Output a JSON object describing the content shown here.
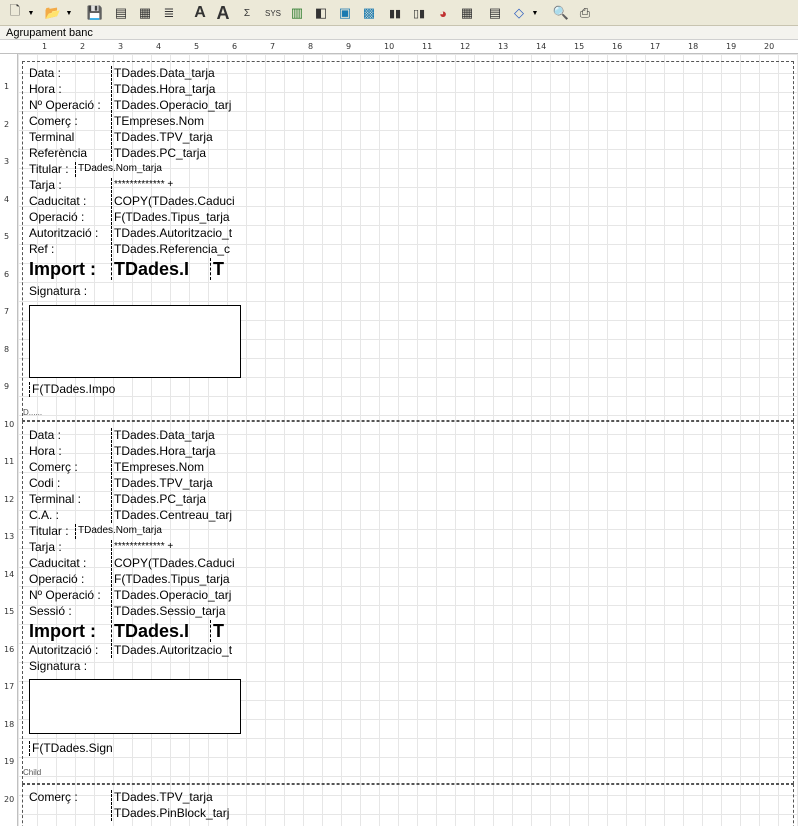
{
  "toolbar": {
    "buttons": [
      {
        "name": "new-icon",
        "glyph": "🗋"
      },
      {
        "name": "open-icon",
        "glyph": "📂"
      },
      {
        "name": "save-icon",
        "glyph": "💾"
      },
      {
        "name": "label-tool-icon",
        "glyph": "▤"
      },
      {
        "name": "db-field-icon",
        "glyph": "▦"
      },
      {
        "name": "memo-icon",
        "glyph": "≣"
      },
      {
        "name": "font-a-icon",
        "glyph": "A"
      },
      {
        "name": "font-a-grow-icon",
        "glyph": "A"
      },
      {
        "name": "expression-icon",
        "glyph": "Σ"
      },
      {
        "name": "system-data-icon",
        "glyph": "SYS"
      },
      {
        "name": "rich-text-icon",
        "glyph": "▥"
      },
      {
        "name": "shape-icon",
        "glyph": "◧"
      },
      {
        "name": "image-icon",
        "glyph": "▣"
      },
      {
        "name": "db-image-icon",
        "glyph": "▩"
      },
      {
        "name": "barcode-icon",
        "glyph": "▮▮"
      },
      {
        "name": "db-barcode-icon",
        "glyph": "▯▮"
      },
      {
        "name": "chart-icon",
        "glyph": "◕"
      },
      {
        "name": "grid-icon",
        "glyph": "▦"
      },
      {
        "name": "report-settings-icon",
        "glyph": "▤"
      },
      {
        "name": "eraser-icon",
        "glyph": "◇"
      },
      {
        "name": "preview-icon",
        "glyph": "🔍"
      },
      {
        "name": "print-icon",
        "glyph": "⎙"
      }
    ]
  },
  "band_title": "Agrupament banc",
  "ruler_h": [
    "1",
    "2",
    "3",
    "4",
    "5",
    "6",
    "7",
    "8",
    "9",
    "10",
    "11",
    "12",
    "13",
    "14",
    "15",
    "16",
    "17",
    "18",
    "19",
    "20"
  ],
  "ruler_v": [
    "1",
    "2",
    "3",
    "4",
    "5",
    "6",
    "7",
    "8",
    "9",
    "10",
    "11",
    "12",
    "13",
    "14",
    "15",
    "16",
    "17",
    "18",
    "19",
    "20"
  ],
  "band1": {
    "labels": [
      "Data :",
      "Hora :",
      "Nº Operació :",
      "Comerç :",
      "Terminal",
      "Referència",
      "Titular :",
      "Tarja :",
      "Caducitat :",
      "Operació :",
      "Autorització :",
      "Ref :",
      "Import :",
      "Signatura :"
    ],
    "values": [
      "TDades.Data_tarja",
      "TDades.Hora_tarja",
      "TDades.Operacio_tarj",
      "TEmpreses.Nom",
      "TDades.TPV_tarja",
      "TDades.PC_tarja",
      "TDades.Nom_tarja",
      "************* +",
      "COPY(TDades.Caduci",
      "F(TDades.Tipus_tarja",
      "TDades.Autoritzacio_t",
      "TDades.Referencia_c",
      "TDades.I",
      "T"
    ],
    "footer_field": "F(TDades.Impo",
    "footer_small": "D......"
  },
  "band2": {
    "labels": [
      "Data :",
      "Hora :",
      "Comerç :",
      "Codi :",
      "Terminal :",
      "C.A. :",
      "Titular :",
      "Tarja :",
      "Caducitat :",
      "Operació :",
      "Nº Operació :",
      "Sessió :",
      "Import :",
      "Autorització :",
      "Signatura :"
    ],
    "values": [
      "TDades.Data_tarja",
      "TDades.Hora_tarja",
      "TEmpreses.Nom",
      "TDades.TPV_tarja",
      "TDades.PC_tarja",
      "TDades.Centreau_tarj",
      "TDades.Nom_tarja",
      "************* +",
      "COPY(TDades.Caduci",
      "F(TDades.Tipus_tarja",
      "TDades.Operacio_tarj",
      "TDades.Sessio_tarja",
      "TDades.I",
      "T",
      "TDades.Autoritzacio_t"
    ],
    "footer_field": "F(TDades.Sign",
    "footer_small": "Child"
  },
  "band3": {
    "labels": [
      "Comerç :"
    ],
    "values": [
      "TDades.TPV_tarja",
      "TDades.PinBlock_tarj"
    ]
  }
}
